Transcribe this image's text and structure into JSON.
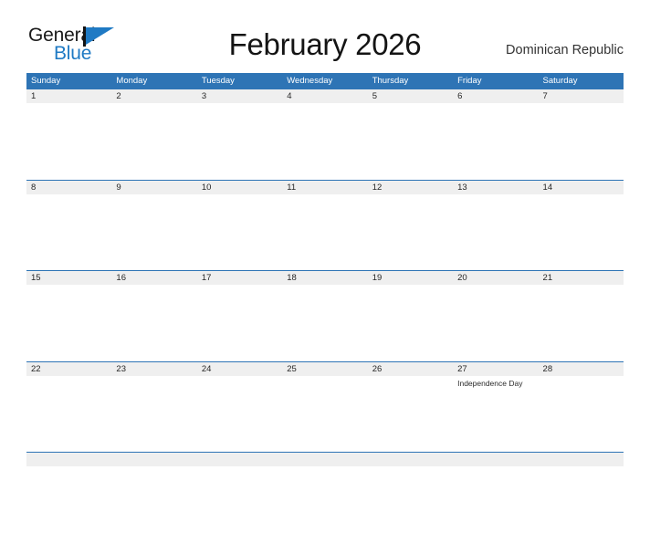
{
  "brand": {
    "name_part1": "General",
    "name_part2": "Blue",
    "flag_icon": "blue-flag-triangle"
  },
  "header": {
    "title": "February 2026",
    "country": "Dominican Republic"
  },
  "colors": {
    "header_blue": "#2E74B5",
    "band_gray": "#EFEFEF",
    "brand_blue": "#1F7AC4",
    "text_dark": "#262626",
    "page_background": "#FFFFFF"
  },
  "calendar": {
    "month": "February",
    "year": "2026",
    "weekday_headers": [
      "Sunday",
      "Monday",
      "Tuesday",
      "Wednesday",
      "Thursday",
      "Friday",
      "Saturday"
    ],
    "weeks": [
      {
        "days": [
          {
            "number": "1",
            "events": []
          },
          {
            "number": "2",
            "events": []
          },
          {
            "number": "3",
            "events": []
          },
          {
            "number": "4",
            "events": []
          },
          {
            "number": "5",
            "events": []
          },
          {
            "number": "6",
            "events": []
          },
          {
            "number": "7",
            "events": []
          }
        ]
      },
      {
        "days": [
          {
            "number": "8",
            "events": []
          },
          {
            "number": "9",
            "events": []
          },
          {
            "number": "10",
            "events": []
          },
          {
            "number": "11",
            "events": []
          },
          {
            "number": "12",
            "events": []
          },
          {
            "number": "13",
            "events": []
          },
          {
            "number": "14",
            "events": []
          }
        ]
      },
      {
        "days": [
          {
            "number": "15",
            "events": []
          },
          {
            "number": "16",
            "events": []
          },
          {
            "number": "17",
            "events": []
          },
          {
            "number": "18",
            "events": []
          },
          {
            "number": "19",
            "events": []
          },
          {
            "number": "20",
            "events": []
          },
          {
            "number": "21",
            "events": []
          }
        ]
      },
      {
        "days": [
          {
            "number": "22",
            "events": []
          },
          {
            "number": "23",
            "events": []
          },
          {
            "number": "24",
            "events": []
          },
          {
            "number": "25",
            "events": []
          },
          {
            "number": "26",
            "events": []
          },
          {
            "number": "27",
            "events": [
              "Independence Day"
            ]
          },
          {
            "number": "28",
            "events": []
          }
        ]
      },
      {
        "days": [
          {
            "number": "",
            "events": []
          },
          {
            "number": "",
            "events": []
          },
          {
            "number": "",
            "events": []
          },
          {
            "number": "",
            "events": []
          },
          {
            "number": "",
            "events": []
          },
          {
            "number": "",
            "events": []
          },
          {
            "number": "",
            "events": []
          }
        ]
      }
    ]
  }
}
